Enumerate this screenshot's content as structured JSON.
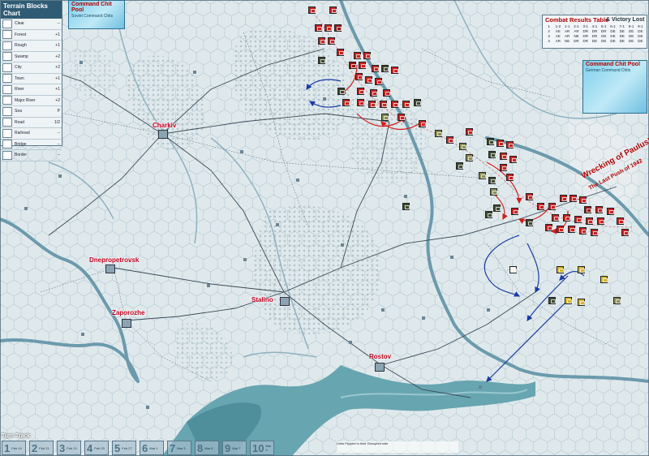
{
  "board": {
    "colors": {
      "base": "#dfe9ec",
      "forest": "#c3d1d6",
      "river": "#6b9aac",
      "sea": "#67a5b0",
      "road": "#3b4a55",
      "soviet": "#d01f1f",
      "axis": "#3d4a2e",
      "move_red": "#d81b1b",
      "move_blue": "#1a3aa8",
      "city_label": "#c8001e"
    }
  },
  "terrain_chart": {
    "title": "Terrain Blocks Chart",
    "rows": [
      {
        "name": "Clear",
        "value": "--"
      },
      {
        "name": "Forest",
        "value": "+1"
      },
      {
        "name": "Rough",
        "value": "+1"
      },
      {
        "name": "Swamp",
        "value": "+2"
      },
      {
        "name": "City",
        "value": "+2"
      },
      {
        "name": "Town",
        "value": "+1"
      },
      {
        "name": "River",
        "value": "+1"
      },
      {
        "name": "Major River",
        "value": "+2"
      },
      {
        "name": "Sea",
        "value": "P"
      },
      {
        "name": "Road",
        "value": "1/2"
      },
      {
        "name": "Railroad",
        "value": "--"
      },
      {
        "name": "Bridge",
        "value": "--"
      },
      {
        "name": "Border",
        "value": "--"
      }
    ]
  },
  "command_pool_left": {
    "title": "Command Chit Pool",
    "subtitle": "Soviet Command Chits"
  },
  "command_pool_right": {
    "title": "Command Chit Pool",
    "subtitle": "German Command Chits"
  },
  "crt": {
    "title": "Combat Results Table",
    "victory": "& Victory Lost",
    "cells": [
      "1",
      "1-2",
      "1-1",
      "2-1",
      "3-1",
      "4-1",
      "5-1",
      "6-1",
      "7-1",
      "8-1",
      "9-1",
      "2",
      "AE",
      "AR",
      "AR",
      "DR",
      "DR",
      "DR",
      "DE",
      "DE",
      "DE",
      "DE",
      "3",
      "AE",
      "AR",
      "NE",
      "DR",
      "DR",
      "DE",
      "DE",
      "DE",
      "DE",
      "DE",
      "4",
      "AR",
      "NE",
      "DR",
      "DR",
      "DE",
      "DE",
      "DE",
      "DE",
      "DE",
      "DE"
    ]
  },
  "cities": [
    {
      "name": "Charkiv"
    },
    {
      "name": "Dnepropetrovsk"
    },
    {
      "name": "Zaporozhe"
    },
    {
      "name": "Stalino"
    },
    {
      "name": "Rostov"
    }
  ],
  "title_art": {
    "line1": "Wrecking of Paulus!",
    "line2": "The Last Push of 1942"
  },
  "turn_track": {
    "title": "Turn Track",
    "turns": [
      {
        "n": "1",
        "date": "Feb 19"
      },
      {
        "n": "2",
        "date": "Feb 21"
      },
      {
        "n": "3",
        "date": "Feb 23"
      },
      {
        "n": "4",
        "date": "Feb 25"
      },
      {
        "n": "5",
        "date": "Feb 27"
      },
      {
        "n": "6",
        "date": "Mar 1"
      },
      {
        "n": "7",
        "date": "Mar 3"
      },
      {
        "n": "8",
        "date": "Mar 5"
      },
      {
        "n": "9",
        "date": "Mar 7"
      },
      {
        "n": "10",
        "date": "Mar 9"
      }
    ]
  },
  "legend_strip": {
    "text": "Units Flipped to their Disrupted side"
  }
}
